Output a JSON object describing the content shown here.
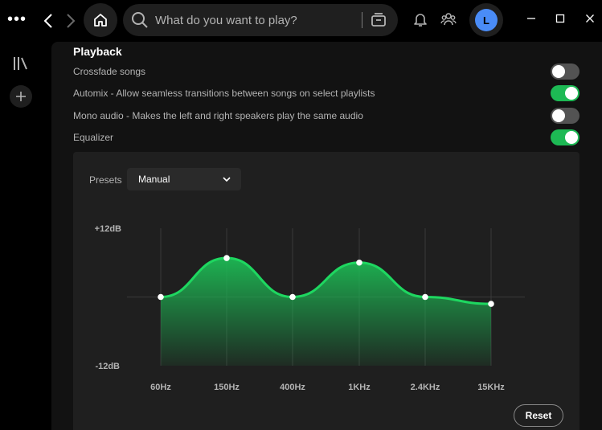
{
  "topbar": {
    "menu_glyph": "•••",
    "search": {
      "placeholder": "What do you want to play?"
    },
    "avatar_initial": "L"
  },
  "icons": [
    "menu-dots-icon",
    "back-chevron-icon",
    "forward-chevron-icon",
    "home-icon",
    "search-icon",
    "browse-icon",
    "bell-icon",
    "friends-icon",
    "minimize-icon",
    "maximize-icon",
    "close-icon",
    "library-icon",
    "plus-icon",
    "chevron-down-icon"
  ],
  "playback": {
    "title": "Playback",
    "settings": [
      {
        "label": "Crossfade songs",
        "on": false
      },
      {
        "label": "Automix - Allow seamless transitions between songs on select playlists",
        "on": true
      },
      {
        "label": "Mono audio - Makes the left and right speakers play the same audio",
        "on": false
      },
      {
        "label": "Equalizer",
        "on": true
      }
    ]
  },
  "equalizer": {
    "presets_label": "Presets",
    "preset_value": "Manual",
    "reset_label": "Reset"
  },
  "colors": {
    "accent": "#1db954",
    "panel": "#121212",
    "eq_panel": "#1f1f1f",
    "avatar": "#4a8cf7"
  },
  "chart_data": {
    "type": "area",
    "categories": [
      "60Hz",
      "150Hz",
      "400Hz",
      "1KHz",
      "2.4KHz",
      "15KHz"
    ],
    "values": [
      0,
      6.8,
      0,
      6,
      0,
      -1.2
    ],
    "ymax_label": "+12dB",
    "ymin_label": "-12dB",
    "ylim": [
      -12,
      12
    ]
  }
}
